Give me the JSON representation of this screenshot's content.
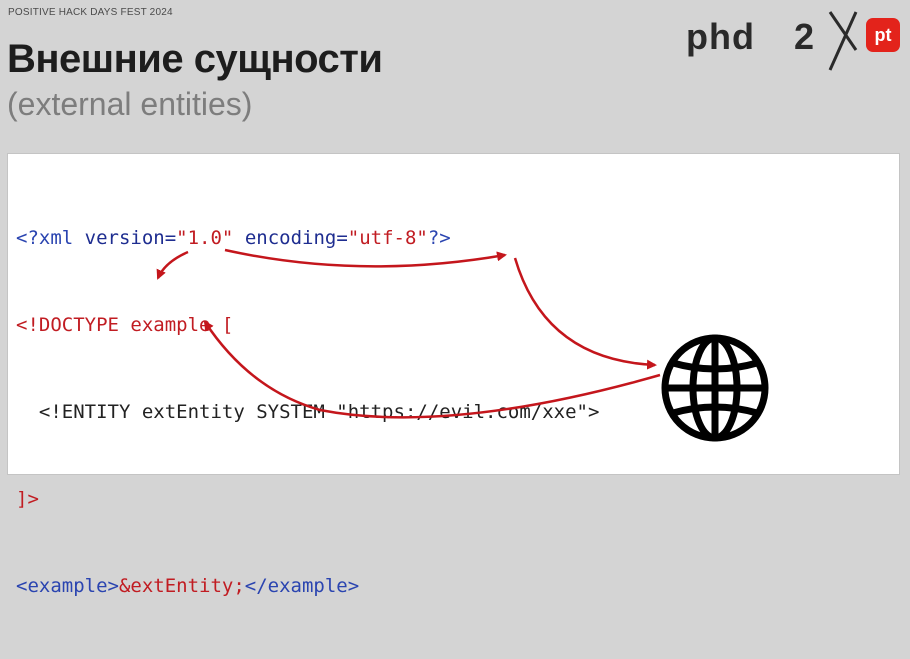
{
  "header": {
    "fest_label": "POSITIVE HACK DAYS FEST 2024",
    "title": "Внешние сущности",
    "subtitle": "(external entities)"
  },
  "logo": {
    "phd": "phd",
    "version": "2",
    "brand": "pt",
    "brand_color": "#e3231b"
  },
  "code": {
    "line1": {
      "open": "<?xml ",
      "attr1": "version=",
      "val1": "\"1.0\"",
      "space": " ",
      "attr2": "encoding=",
      "val2": "\"utf-8\"",
      "close": "?>"
    },
    "line2": {
      "open": "<!",
      "keyword": "DOCTYPE",
      "rest": " example ["
    },
    "line3": {
      "indent": "  ",
      "text": "<!ENTITY extEntity SYSTEM \"https://evil.com/xxe\">"
    },
    "line4": {
      "text": "]>"
    },
    "line5": {
      "open_tag": "<example>",
      "entity_ref": "&extEntity;",
      "close_tag": "</example>"
    }
  },
  "colors": {
    "arrow": "#c4161c",
    "tag": "#2a44b0",
    "string": "#c11c22"
  },
  "icons": {
    "network": "globe-icon"
  }
}
